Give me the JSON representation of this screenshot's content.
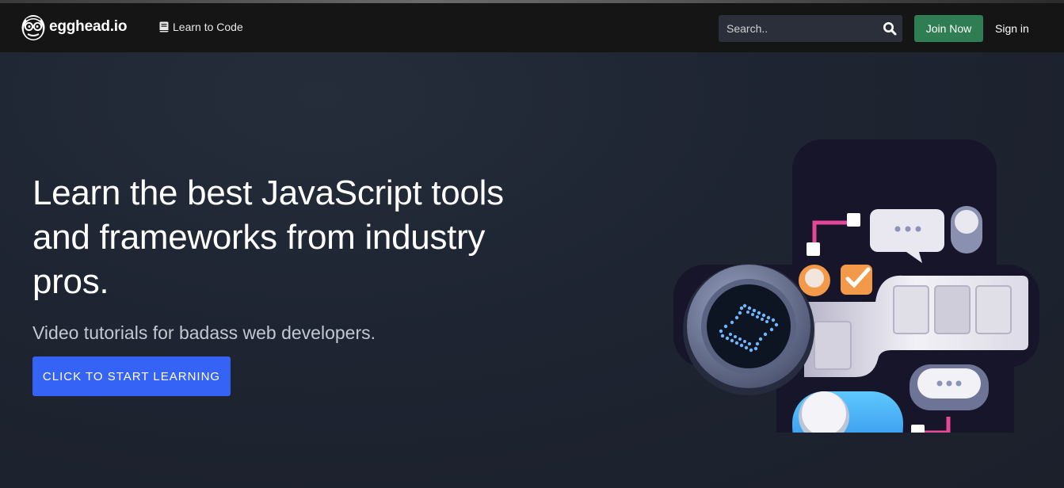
{
  "brand": {
    "name": "egghead.io",
    "logo_icon": "egghead-logo-icon"
  },
  "nav": {
    "learn_link": "Learn to Code",
    "learn_icon": "book-icon"
  },
  "search": {
    "placeholder": "Search..",
    "icon": "search-icon"
  },
  "auth": {
    "join_label": "Join Now",
    "signin_label": "Sign in"
  },
  "hero": {
    "title": "Learn the best JavaScript tools and frameworks from industry pros.",
    "subtitle": "Video tutorials for badass web developers.",
    "cta_label": "CLICK TO START LEARNING",
    "illustration_icon": "hourglass-illustration-icon"
  },
  "colors": {
    "background": "#1d232f",
    "navbar": "#151515",
    "join_button": "#2e7d53",
    "cta_button": "#3563f5",
    "search_bg": "#2a2f3a"
  }
}
